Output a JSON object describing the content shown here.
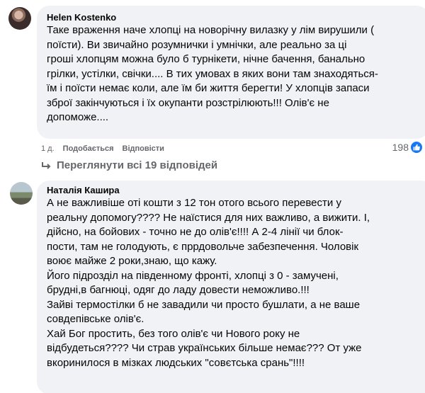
{
  "comments": [
    {
      "author": "Helen Kostenko",
      "lines": [
        "Таке враження наче хлопці на новорічну вилазку у лім вирушили (",
        "поїсти). Ви звичайно розумнички і умнічки, але реально за ці",
        "гроші хлопцям можна було б турнікети, нічне бачення, банально",
        "грілки, устілки, свічки.... В тих умовах в яких вони там знаходяться-",
        "їм і поїсти немає коли, але їм би життя берегти! У хлопців запаси",
        "зброї закінчуються і їх окупанти розстрілюють!!! Олів'є не",
        "допоможе...."
      ],
      "time": "1 д.",
      "like_label": "Подобається",
      "reply_label": "Відповісти",
      "reaction_count": "198"
    },
    {
      "author": "Наталія Кашира",
      "lines": [
        "А не важливіше оті кошти з 12 тон отого всього перевести у",
        "реальну допомогу???? Не наїстися для них важливо, а вижити. І,",
        "дійсно, на бойових - точно не до олів'є!!!! А 2-4 лінії чи блок-",
        "пости, там не голодують, є пррдовольче забезпечення. Чоловік",
        "воює майже 2 роки,знаю, що кажу.",
        "Його підрозділ на південному фронті, хлопці з 0 - замучені,",
        "брудні,в багнюці, одяг до ладу довести неможливо.!!!",
        "Зайві термостілки б не завадили чи просто бушлати, а не ваше",
        "совдепівське олів'є.",
        "Хай Бог простить, без того олів'є чи Нового року не",
        "відбудеться???? Чи страв українських більше немає??? От уже",
        "вкоринилося в мізках людських \"совєтська срань\"!!!!"
      ]
    }
  ],
  "replies": {
    "label": "Переглянути всі 19 відповідей"
  },
  "colors": {
    "bubble": "#f0f2f5",
    "meta": "#65676b",
    "like": "#1877f2"
  },
  "icons": {
    "reaction": "thumbs-up-icon",
    "replies": "reply-arrow-icon"
  }
}
